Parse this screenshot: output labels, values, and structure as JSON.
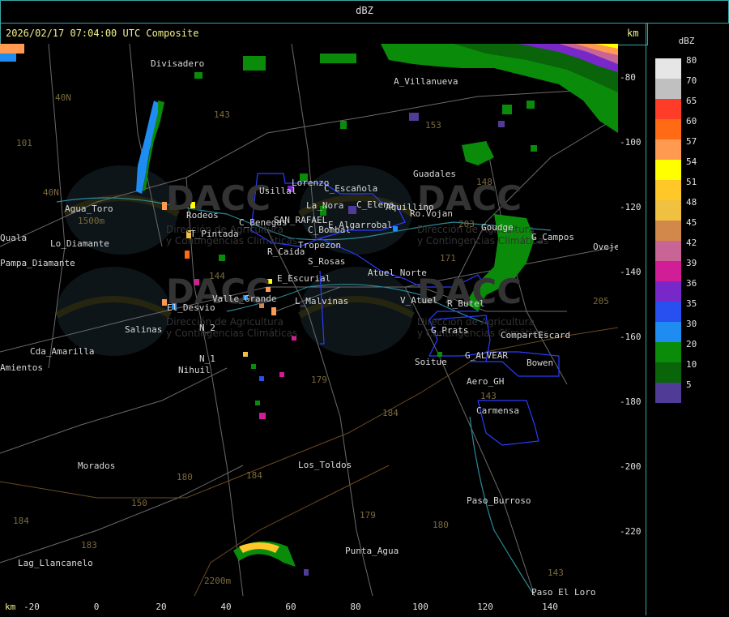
{
  "title": "dBZ",
  "timestamp": "2026/02/17 07:04:00 UTC Composite",
  "km_unit": "km",
  "legend": {
    "title": "dBZ",
    "items": [
      {
        "value": "80",
        "color": "#e6e6e6"
      },
      {
        "value": "70",
        "color": "#c0c0c0"
      },
      {
        "value": "65",
        "color": "#ff3c28"
      },
      {
        "value": "60",
        "color": "#ff6a14"
      },
      {
        "value": "57",
        "color": "#ff9a50"
      },
      {
        "value": "54",
        "color": "#ffff00"
      },
      {
        "value": "51",
        "color": "#ffc828"
      },
      {
        "value": "48",
        "color": "#f0c040"
      },
      {
        "value": "45",
        "color": "#d2884a"
      },
      {
        "value": "42",
        "color": "#c86496"
      },
      {
        "value": "39",
        "color": "#d21e96"
      },
      {
        "value": "36",
        "color": "#7828c8"
      },
      {
        "value": "35",
        "color": "#2850f0"
      },
      {
        "value": "30",
        "color": "#1e8cf0"
      },
      {
        "value": "20",
        "color": "#0a8c0a"
      },
      {
        "value": "10",
        "color": "#0a640a"
      },
      {
        "value": "5",
        "color": "#503c96"
      }
    ]
  },
  "y_axis": [
    "-80",
    "-100",
    "-120",
    "-140",
    "-160",
    "-180",
    "-200",
    "-220"
  ],
  "x_axis": [
    "-20",
    "0",
    "20",
    "40",
    "60",
    "80",
    "100",
    "120",
    "140"
  ],
  "places": [
    "Divisadero",
    "A_Villanueva",
    "Guadales",
    "Usillal",
    "Lorenzo",
    "C_Escañola",
    "C_Elena",
    "Aquillino",
    "Ro.Vojan",
    "Agua_Toro",
    "Rodeos",
    "T_Pintada",
    "La_Nora",
    "C_Benegas",
    "SAN_RAFAEL",
    "C_Bombal",
    "E_Algarrobal",
    "G_Campos",
    "Goudge",
    "Ovejeria",
    "Quala",
    "Pampa_Diamante",
    "Lo_Diamante",
    "R_Caida",
    "Tropezon",
    "S_Rosas",
    "Atuel_Norte",
    "E_Escurial",
    "Valle_Grande",
    "L_Malvinas",
    "V_Atuel",
    "R_Butel",
    "El_Desvio",
    "Salinas",
    "N_2",
    "G_Prats",
    "CompartEscard",
    "Cda_Amarilla",
    "Amientos",
    "N_1",
    "Nihuil",
    "G_ALVEAR",
    "Soitue",
    "Bowen",
    "Aero_GH",
    "Carmensa",
    "Morados",
    "Los_Toldos",
    "Paso_Burroso",
    "Punta_Agua",
    "Lag_Llancanelo",
    "Paso_El_Loro"
  ],
  "routes": [
    "143",
    "40N",
    "101",
    "40N",
    "153",
    "148",
    "203",
    "171",
    "144",
    "179",
    "184",
    "143",
    "180",
    "184",
    "179",
    "180",
    "183",
    "184",
    "143",
    "150",
    "205"
  ],
  "watermark": {
    "logo": "DACC",
    "subtitle1": "Dirección de Agricultura",
    "subtitle2": "y Contingencias Climáticas"
  },
  "heights": [
    "1500m",
    "2200m"
  ]
}
